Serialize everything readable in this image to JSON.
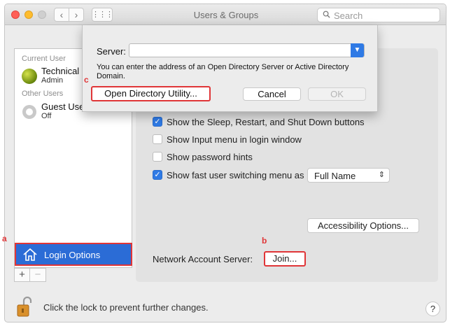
{
  "window": {
    "title": "Users & Groups",
    "nav_back": "‹",
    "nav_forward": "›",
    "grid_glyph": "⋮⋮⋮"
  },
  "search": {
    "placeholder": "Search"
  },
  "user_list": {
    "current_header": "Current User",
    "other_header": "Other Users",
    "users": [
      {
        "name": "Technical",
        "role": "Admin"
      },
      {
        "name": "Guest User",
        "role": "Off"
      }
    ],
    "login_options": "Login Options",
    "add_button": "+",
    "remove_button": "−"
  },
  "options": {
    "sleep": {
      "label": "Show the Sleep, Restart, and Shut Down buttons",
      "checked": true
    },
    "input_menu": {
      "label": "Show Input menu in login window",
      "checked": false
    },
    "password_hints": {
      "label": "Show password hints",
      "checked": false
    },
    "fast_switching": {
      "label": "Show fast user switching menu as",
      "checked": true,
      "value": "Full Name"
    }
  },
  "accessibility_button": "Accessibility Options...",
  "network_server": {
    "label": "Network Account Server:",
    "join_button": "Join..."
  },
  "lock": {
    "text": "Click the lock to prevent further changes."
  },
  "help_button": "?",
  "sheet": {
    "server_label": "Server:",
    "server_value": "",
    "help_text": "You can enter the address of an Open Directory Server or Active Directory Domain.",
    "open_directory_button": "Open Directory Utility...",
    "cancel_button": "Cancel",
    "ok_button": "OK"
  },
  "annotations": {
    "a": "a",
    "b": "b",
    "c": "c"
  },
  "colors": {
    "accent": "#2f7ae5",
    "selection": "#2b6cd6",
    "annotation": "#e03537"
  }
}
